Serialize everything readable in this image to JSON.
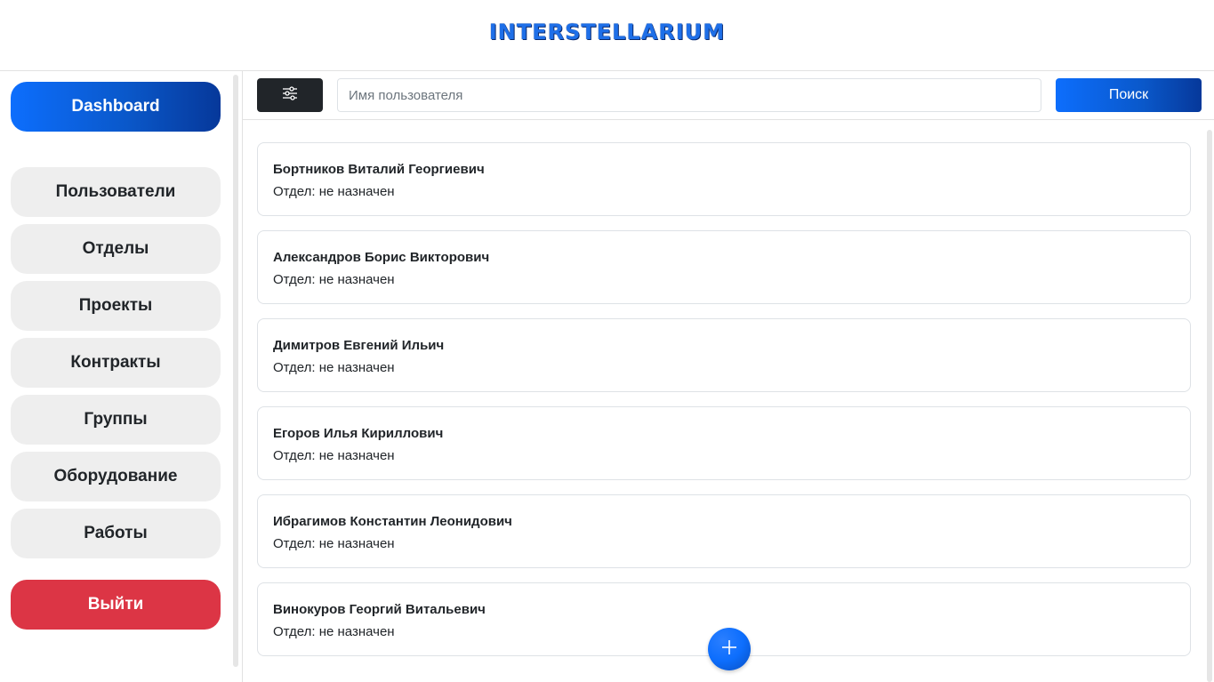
{
  "header": {
    "logo_text": "INTERSTELLARIUM"
  },
  "sidebar": {
    "dashboard_label": "Dashboard",
    "items": [
      {
        "label": "Пользователи"
      },
      {
        "label": "Отделы"
      },
      {
        "label": "Проекты"
      },
      {
        "label": "Контракты"
      },
      {
        "label": "Группы"
      },
      {
        "label": "Оборудование"
      },
      {
        "label": "Работы"
      }
    ],
    "logout_label": "Выйти"
  },
  "toolbar": {
    "filter_icon": "sliders-icon",
    "search_placeholder": "Имя пользователя",
    "search_value": "",
    "search_button_label": "Поиск"
  },
  "users": [
    {
      "name": "Бортников Виталий Георгиевич",
      "department": "Отдел: не назначен"
    },
    {
      "name": "Александров Борис Викторович",
      "department": "Отдел: не назначен"
    },
    {
      "name": "Димитров Евгений Ильич",
      "department": "Отдел: не назначен"
    },
    {
      "name": "Егоров Илья Кириллович",
      "department": "Отдел: не назначен"
    },
    {
      "name": "Ибрагимов Константин Леонидович",
      "department": "Отдел: не назначен"
    },
    {
      "name": "Винокуров Георгий Витальевич",
      "department": "Отдел: не назначен"
    }
  ],
  "fab": {
    "icon": "plus-icon"
  },
  "colors": {
    "accent": "#0d6efd",
    "danger": "#dc3545",
    "dark": "#212529",
    "nav_bg": "#eeeeee"
  }
}
